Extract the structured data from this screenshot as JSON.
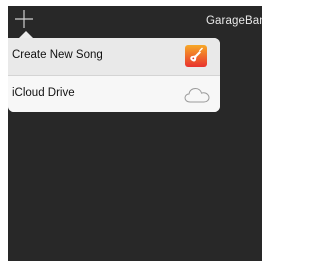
{
  "header": {
    "app_title": "GarageBand",
    "add_icon": "plus-icon"
  },
  "menu": {
    "items": [
      {
        "label": "Create New Song",
        "icon": "garageband-guitar-icon"
      },
      {
        "label": "iCloud Drive",
        "icon": "cloud-icon"
      }
    ]
  },
  "colors": {
    "background": "#282828",
    "popover": "#f7f7f7",
    "selected_row": "#e9e9e9",
    "icon_orange": "#f58a1f",
    "icon_red": "#e8322e"
  }
}
